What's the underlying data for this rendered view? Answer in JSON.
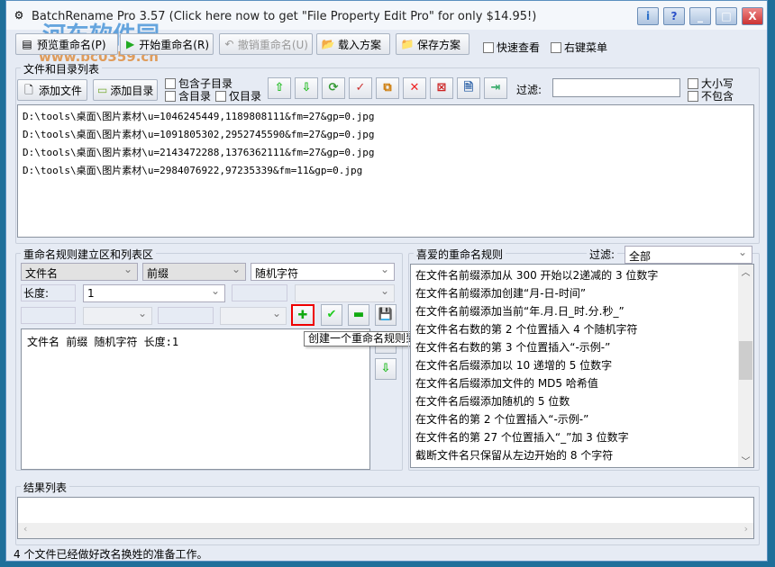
{
  "window": {
    "title": "BatchRename Pro 3.57  (Click here now to get \"File Property Edit Pro\" for only $14.95!)",
    "buttons": [
      "info",
      "help",
      "minimize",
      "maximize",
      "close"
    ]
  },
  "watermark": {
    "name": "河东软件园",
    "url": "www.pc0359.cn"
  },
  "toolbar": {
    "preview": "预览重命名(P)",
    "start": "开始重命名(R)",
    "undo": "撤销重命名(U)",
    "load": "载入方案",
    "save": "保存方案",
    "quick_view": "快速查看",
    "context_menu": "右键菜单"
  },
  "files": {
    "group_label": "文件和目录列表",
    "add_file": "添加文件",
    "add_dir": "添加目录",
    "include_sub": "包含子目录",
    "include_dir": "含目录",
    "only_dir": "仅目录",
    "filter_label": "过滤:",
    "filter_value": "",
    "case": "大小写",
    "exclude": "不包含",
    "items": [
      "D:\\tools\\桌面\\图片素材\\u=1046245449,1189808111&fm=27&gp=0.jpg",
      "D:\\tools\\桌面\\图片素材\\u=1091805302,2952745590&fm=27&gp=0.jpg",
      "D:\\tools\\桌面\\图片素材\\u=2143472288,1376362111&fm=27&gp=0.jpg",
      "D:\\tools\\桌面\\图片素材\\u=2984076922,97235339&fm=11&gp=0.jpg"
    ]
  },
  "rules": {
    "group_label": "重命名规则建立区和列表区",
    "target": "文件名",
    "position": "前缀",
    "type": "随机字符",
    "length_label": "长度:",
    "length_value": "1",
    "list": [
      "文件名 前缀 随机字符 长度:1"
    ],
    "tooltip": "创建一个重命名规则到列表区"
  },
  "favorites": {
    "group_label": "喜爱的重命名规则",
    "filter_label": "过滤:",
    "filter_value": "全部",
    "scroll_fraction": 0.45,
    "items": [
      "在文件名前缀添加从 300 开始以2递减的 3 位数字",
      "在文件名前缀添加创建“月-日-时间”",
      "在文件名前缀添加当前“年.月.日_时.分.秒_”",
      "在文件名右数的第 2 个位置插入 4 个随机字符",
      "在文件名右数的第 3 个位置插入“-示例-”",
      "在文件名后缀添加以 10 递增的 5 位数字",
      "在文件名后缀添加文件的 MD5 哈希值",
      "在文件名后缀添加随机的 5 位数",
      "在文件名的第 2 个位置插入“-示例-”",
      "在文件名的第 27 个位置插入“_”加 3 位数字",
      "截断文件名只保留从左边开始的 8 个字符"
    ]
  },
  "results": {
    "group_label": "结果列表"
  },
  "status": "4 个文件已经做好改名换姓的准备工作。"
}
